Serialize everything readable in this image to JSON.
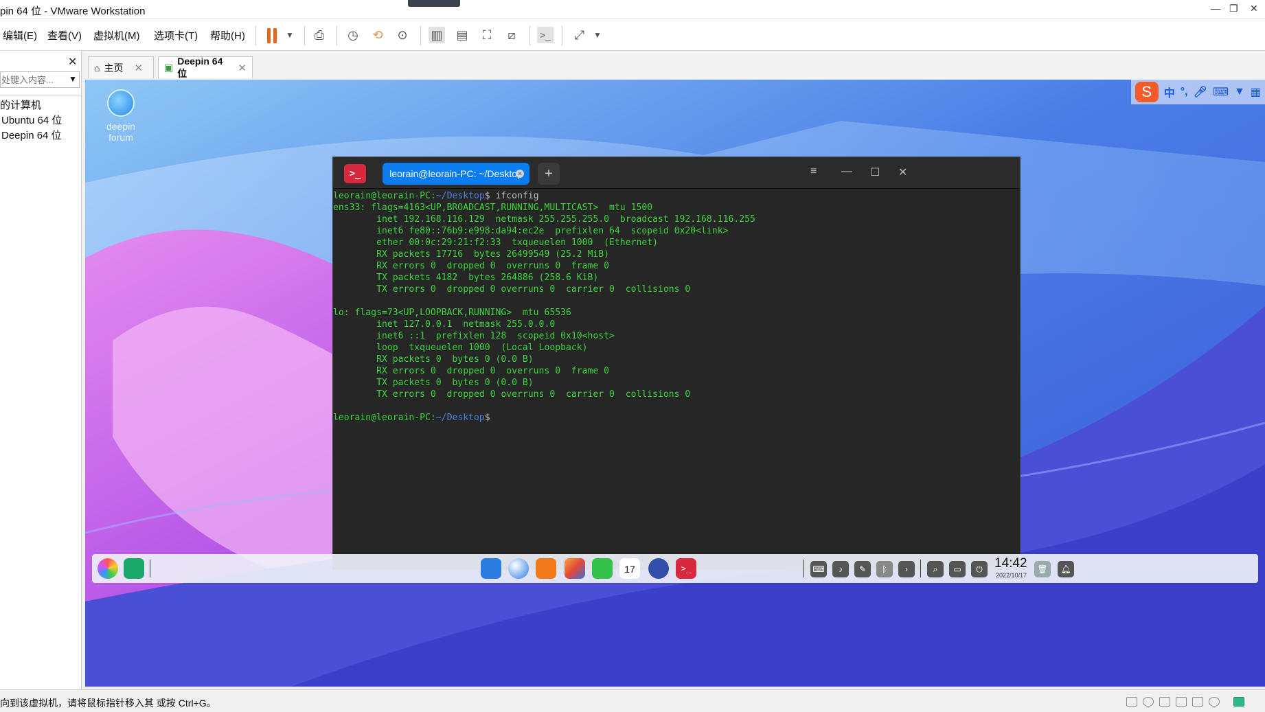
{
  "window": {
    "title": "pin 64 位 - VMware Workstation"
  },
  "menu": [
    "编辑(E)",
    "查看(V)",
    "虚拟机(M)",
    "选项卡(T)",
    "帮助(H)"
  ],
  "library": {
    "search_placeholder": "处键入内容...",
    "items": [
      "的计算机",
      "Ubuntu 64 位",
      "Deepin 64 位"
    ]
  },
  "tabs": [
    {
      "label": "主页"
    },
    {
      "label": "Deepin 64 位"
    }
  ],
  "guest": {
    "desktop_icon_label_1": "deepin",
    "desktop_icon_label_2": "forum",
    "input_method": [
      "中",
      "°,"
    ],
    "terminal": {
      "tab_title": "leorain@leorain-PC: ~/Desktop",
      "prompt_user": "leorain@leorain-PC",
      "prompt_path": "~/Desktop",
      "command": "ifconfig",
      "output": [
        "ens33: flags=4163<UP,BROADCAST,RUNNING,MULTICAST>  mtu 1500",
        "        inet 192.168.116.129  netmask 255.255.255.0  broadcast 192.168.116.255",
        "        inet6 fe80::76b9:e998:da94:ec2e  prefixlen 64  scopeid 0x20<link>",
        "        ether 00:0c:29:21:f2:33  txqueuelen 1000  (Ethernet)",
        "        RX packets 17716  bytes 26499549 (25.2 MiB)",
        "        RX errors 0  dropped 0  overruns 0  frame 0",
        "        TX packets 4182  bytes 264886 (258.6 KiB)",
        "        TX errors 0  dropped 0 overruns 0  carrier 0  collisions 0",
        "",
        "lo: flags=73<UP,LOOPBACK,RUNNING>  mtu 65536",
        "        inet 127.0.0.1  netmask 255.0.0.0",
        "        inet6 ::1  prefixlen 128  scopeid 0x10<host>",
        "        loop  txqueuelen 1000  (Local Loopback)",
        "        RX packets 0  bytes 0 (0.0 B)",
        "        RX errors 0  dropped 0  overruns 0  frame 0",
        "        TX packets 0  bytes 0 (0.0 B)",
        "        TX errors 0  dropped 0 overruns 0  carrier 0  collisions 0",
        ""
      ]
    },
    "dock": {
      "calendar_day": "17",
      "time": "14:42",
      "date": "2022/10/17"
    }
  },
  "status": {
    "message": "向到该虚拟机，请将鼠标指针移入其    或按 Ctrl+G。"
  },
  "colors": {
    "accent": "#0a7ef0",
    "terminal_green": "#3bd53b",
    "pause": "#e06a1b"
  }
}
